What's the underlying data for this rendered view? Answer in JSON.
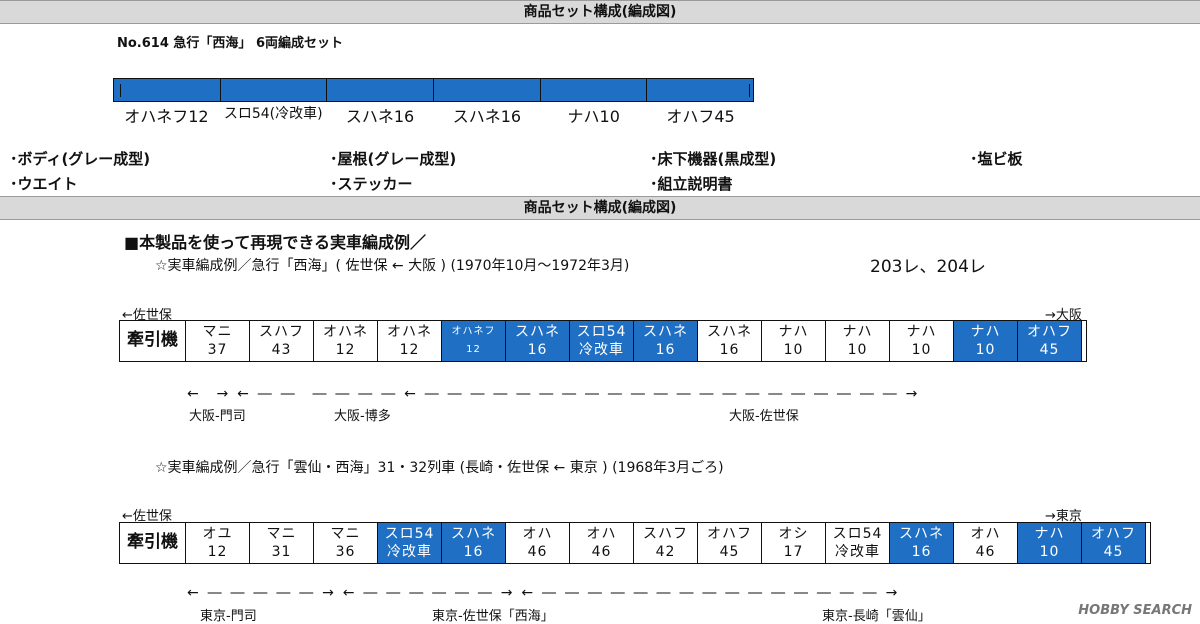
{
  "header_title": "商品セット構成(編成図)",
  "header_title_2": "商品セット構成(編成図)",
  "set_name": "No.614 急行「西海」 6両編成セット",
  "set_cars": [
    "オハネフ12",
    "スロ54(冷改車)",
    "スハネ16",
    "スハネ16",
    "ナハ10",
    "オハフ45"
  ],
  "parts": [
    "･ボディ(グレー成型)",
    "･屋根(グレー成型)",
    "･床下機器(黒成型)",
    "･塩ビ板",
    "･ウエイト",
    "･ステッカー",
    "･組立説明書"
  ],
  "section_title": "■本製品を使って再現できる実車編成例／",
  "example1": {
    "title": "☆実車編成例／急行「西海」( 佐世保 ← 大阪 ) (1970年10月～1972年3月)",
    "train_no": "203レ、204レ",
    "left_end": "←佐世保",
    "right_end": "→大阪",
    "loco": "牽引機",
    "cars": [
      {
        "name": "マニ",
        "num": "37",
        "blue": false
      },
      {
        "name": "スハフ",
        "num": "43",
        "blue": false
      },
      {
        "name": "オハネ",
        "num": "12",
        "blue": false
      },
      {
        "name": "オハネ",
        "num": "12",
        "blue": false
      },
      {
        "name": "オハネフ",
        "num": "12",
        "blue": true,
        "small": true
      },
      {
        "name": "スハネ",
        "num": "16",
        "blue": true
      },
      {
        "name": "スロ54",
        "num": "冷改車",
        "blue": true
      },
      {
        "name": "スハネ",
        "num": "16",
        "blue": true
      },
      {
        "name": "スハネ",
        "num": "16",
        "blue": false
      },
      {
        "name": "ナハ",
        "num": "10",
        "blue": false
      },
      {
        "name": "ナハ",
        "num": "10",
        "blue": false
      },
      {
        "name": "ナハ",
        "num": "10",
        "blue": false
      },
      {
        "name": "ナハ",
        "num": "10",
        "blue": true
      },
      {
        "name": "オハフ",
        "num": "45",
        "blue": true
      }
    ],
    "segments": [
      "大阪-門司",
      "大阪-博多",
      "大阪-佐世保"
    ]
  },
  "example2": {
    "title": "☆実車編成例／急行「雲仙・西海」31・32列車 (長崎・佐世保 ← 東京 ) (1968年3月ごろ)",
    "left_end": "←佐世保",
    "right_end": "→東京",
    "loco": "牽引機",
    "cars": [
      {
        "name": "オユ",
        "num": "12",
        "blue": false
      },
      {
        "name": "マニ",
        "num": "31",
        "blue": false
      },
      {
        "name": "マニ",
        "num": "36",
        "blue": false
      },
      {
        "name": "スロ54",
        "num": "冷改車",
        "blue": true
      },
      {
        "name": "スハネ",
        "num": "16",
        "blue": true
      },
      {
        "name": "オハ",
        "num": "46",
        "blue": false
      },
      {
        "name": "オハ",
        "num": "46",
        "blue": false
      },
      {
        "name": "スハフ",
        "num": "42",
        "blue": false
      },
      {
        "name": "オハフ",
        "num": "45",
        "blue": false
      },
      {
        "name": "オシ",
        "num": "17",
        "blue": false
      },
      {
        "name": "スロ54",
        "num": "冷改車",
        "blue": false
      },
      {
        "name": "スハネ",
        "num": "16",
        "blue": true
      },
      {
        "name": "オハ",
        "num": "46",
        "blue": false
      },
      {
        "name": "ナハ",
        "num": "10",
        "blue": true
      },
      {
        "name": "オハフ",
        "num": "45",
        "blue": true
      }
    ],
    "segments": [
      "東京-門司",
      "東京-佐世保「西海」",
      "東京-長崎「雲仙」"
    ]
  },
  "watermark": "HOBBY SEARCH",
  "colors": {
    "car_blue": "#1f6fc5",
    "header_gray": "#d9d9d9"
  }
}
